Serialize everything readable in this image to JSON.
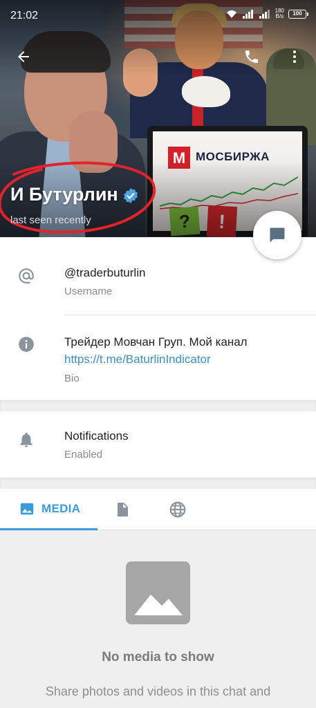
{
  "status_bar": {
    "time": "21:02",
    "net_speed_value": "180",
    "net_speed_unit": "B/s",
    "battery": "100"
  },
  "header": {
    "profile_name": "И Бутурлин",
    "last_seen": "last seen recently",
    "photo_text": "МОСБИРЖА",
    "sticky_question": "?",
    "sticky_exclamation": "!",
    "icons": {
      "back": "arrow-left-icon",
      "call": "phone-icon",
      "more": "more-vertical-icon",
      "verified": "verified-badge-icon",
      "fab": "message-icon"
    }
  },
  "info": {
    "username": {
      "value": "@traderbuturlin",
      "label": "Username",
      "icon": "at-icon"
    },
    "bio": {
      "text": "Трейдер Мовчан Груп. Мой канал",
      "link": "https://t.me/BaturlinIndicator",
      "label": "Bio",
      "icon": "info-icon"
    }
  },
  "notifications": {
    "title": "Notifications",
    "status": "Enabled",
    "icon": "bell-icon"
  },
  "tabs": {
    "media_label": "MEDIA",
    "active": "media",
    "icons": {
      "media": "image-icon",
      "files": "file-icon",
      "links": "globe-icon"
    }
  },
  "empty_state": {
    "title": "No media to show",
    "subtitle": "Share photos and videos in this chat and"
  },
  "colors": {
    "accent": "#3b9ad9",
    "link": "#3b8fc6",
    "highlight_circle": "#e3232a"
  }
}
